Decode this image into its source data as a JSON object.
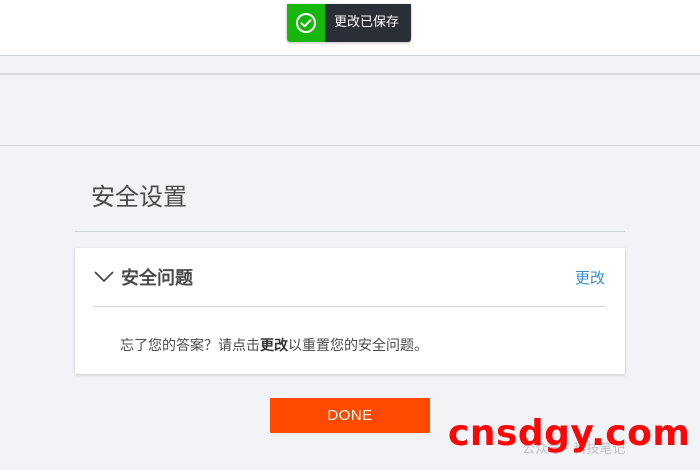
{
  "toast": {
    "icon": "check-circle-icon",
    "message": "更改已保存",
    "colors": {
      "icon_bg": "#16b70d",
      "text_bg": "#2b2e36"
    }
  },
  "page": {
    "section_title": "安全设置"
  },
  "security_card": {
    "expand_icon": "chevron-down-icon",
    "title": "安全问题",
    "change_link": "更改",
    "body_prefix": "忘了您的答案？请点击",
    "body_bold": "更改",
    "body_suffix": "以重置您的安全问题。"
  },
  "done_button": {
    "label": "DONE",
    "color": "#ff4a00"
  },
  "watermark": {
    "text": "cnsdgy.com",
    "sub_text": "公众号 · 科技笔记",
    "color": "#ff0505"
  }
}
